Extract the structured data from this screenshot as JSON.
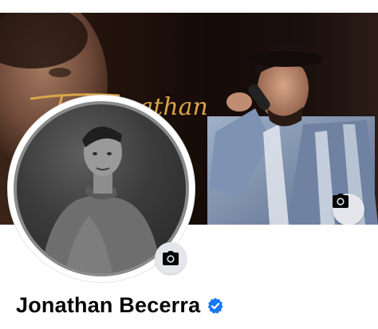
{
  "profile": {
    "name": "Jonathan Becerra",
    "verified": true,
    "cover_signature": "Jonathan"
  },
  "icons": {
    "cover_camera": "camera-icon",
    "profile_camera": "camera-icon",
    "verified": "verified-badge-icon"
  },
  "colors": {
    "verified_blue": "#1877f2",
    "camera_button_bg": "#e4e6eb",
    "name_text": "#050505"
  }
}
